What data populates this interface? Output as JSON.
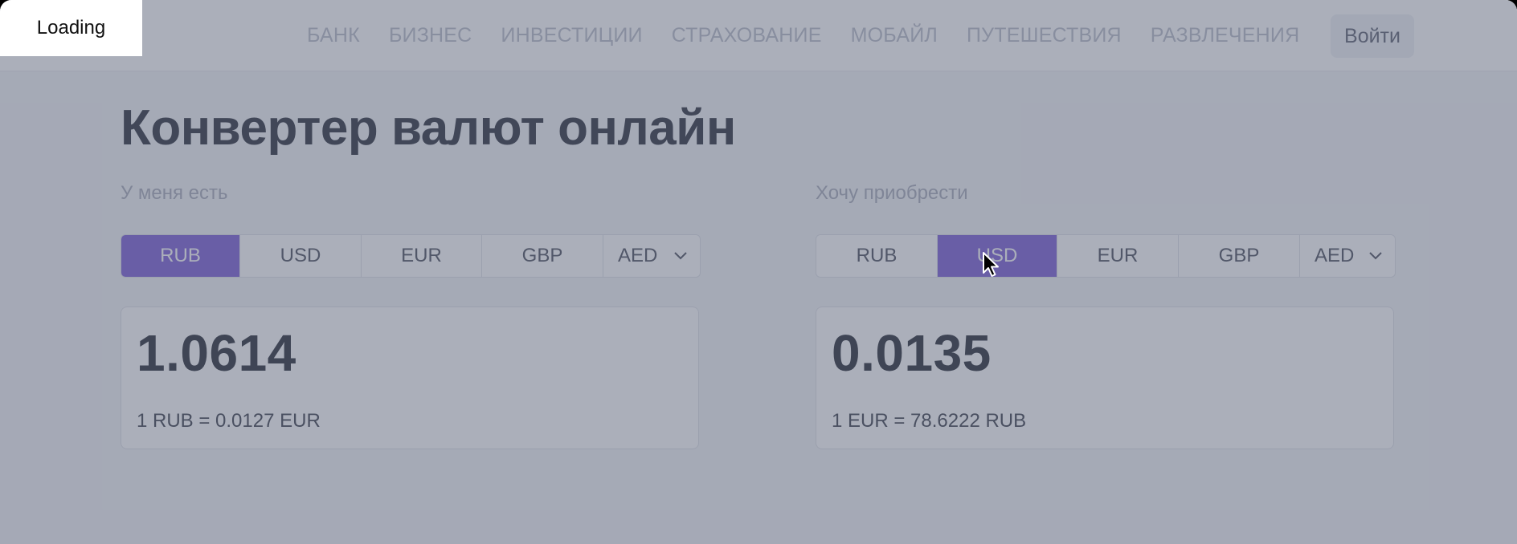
{
  "header": {
    "nav": [
      "БАНК",
      "БИЗНЕС",
      "ИНВЕСТИЦИИ",
      "СТРАХОВАНИЕ",
      "МОБАЙЛ",
      "ПУТЕШЕСТВИЯ",
      "РАЗВЛЕЧЕНИЯ"
    ],
    "login_label": "Войти"
  },
  "page": {
    "title": "Конвертер валют онлайн"
  },
  "from": {
    "label": "У меня есть",
    "currencies": [
      "RUB",
      "USD",
      "EUR",
      "GBP"
    ],
    "dropdown": "AED",
    "selected": "RUB",
    "amount": "1.0614",
    "rate": "1 RUB = 0.0127 EUR"
  },
  "to": {
    "label": "Хочу приобрести",
    "currencies": [
      "RUB",
      "USD",
      "EUR",
      "GBP"
    ],
    "dropdown": "AED",
    "selected": "USD",
    "amount": "0.0135",
    "rate": "1 EUR = 78.6222 RUB"
  },
  "overlay": {
    "loading_text": "Loading"
  },
  "colors": {
    "accent": "#7b5cd6",
    "overlay": "#575f76"
  },
  "icons": {
    "dropdown": "chevron-down-icon",
    "cursor": "mouse-pointer-icon"
  }
}
